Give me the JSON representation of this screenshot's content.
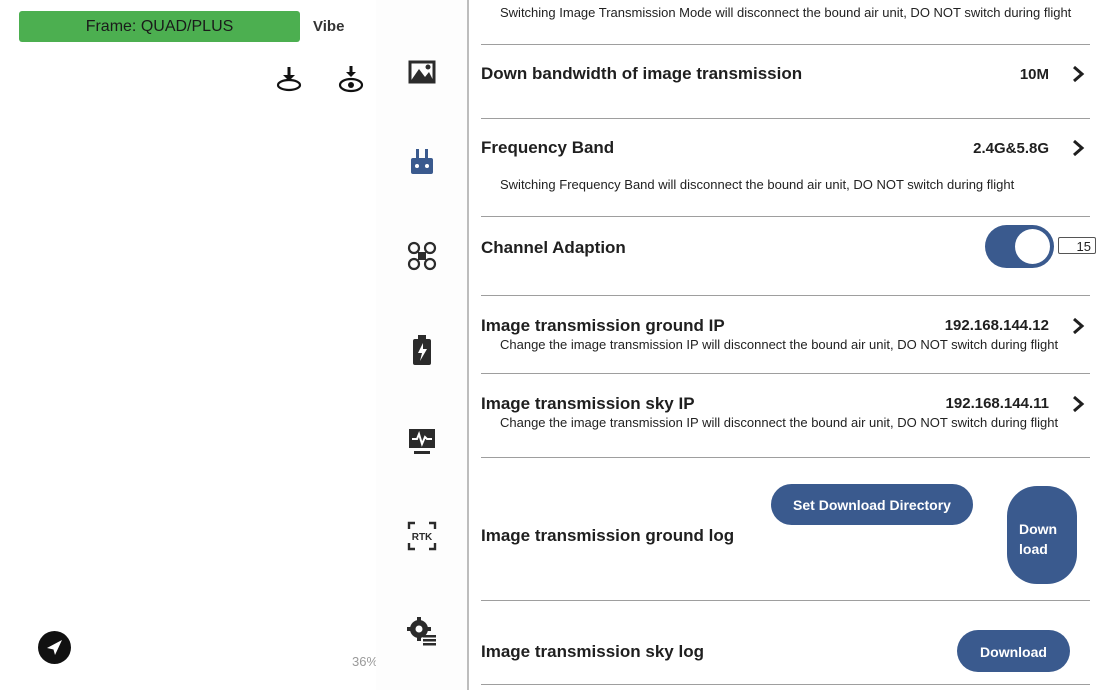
{
  "left_panel": {
    "frame_label": "Frame: QUAD/PLUS",
    "vibe_label": "Vibe",
    "percent_text": "36%",
    "icons": [
      "download-to-drone-icon",
      "download-log-icon",
      "send-icon"
    ]
  },
  "icon_rail": {
    "items": [
      "image-transmission-icon",
      "remote-controller-icon",
      "drone-frame-icon",
      "battery-icon",
      "monitor-icon",
      "rtk-icon",
      "settings-gear-icon"
    ],
    "rtk_label": "RTK"
  },
  "settings": {
    "top_partial_desc": "Switching Image Transmission Mode will disconnect the bound air unit, DO NOT switch during flight",
    "bandwidth": {
      "title": "Down bandwidth of image transmission",
      "value": "10M"
    },
    "frequency": {
      "title": "Frequency Band",
      "value": "2.4G&5.8G",
      "desc": "Switching Frequency Band will disconnect the bound air unit, DO NOT switch during flight"
    },
    "channel": {
      "title": "Channel Adaption",
      "enabled": true,
      "channel_number": "15"
    },
    "ground_ip": {
      "title": "Image transmission ground IP",
      "value": "192.168.144.12",
      "desc": "Change the image transmission IP will disconnect the bound air unit, DO NOT switch during flight"
    },
    "sky_ip": {
      "title": "Image transmission sky IP",
      "value": "192.168.144.11",
      "desc": "Change the image transmission IP will disconnect the bound air unit, DO NOT switch during flight"
    },
    "ground_log": {
      "title": "Image transmission ground log",
      "set_dir_label": "Set Download Directory",
      "download_label": "Download"
    },
    "sky_log": {
      "title": "Image transmission sky log",
      "download_label": "Download"
    }
  },
  "colors": {
    "accent": "#3a5a8e",
    "frame_badge": "#4caf50"
  }
}
